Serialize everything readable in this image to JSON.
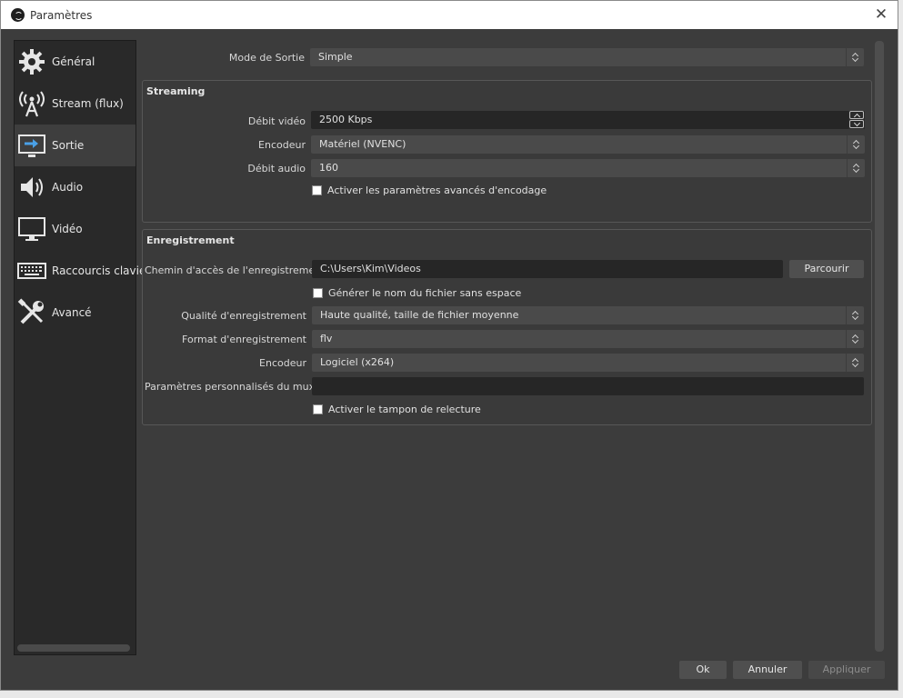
{
  "window": {
    "title": "Paramètres"
  },
  "sidebar": {
    "items": [
      {
        "label": "Général",
        "icon": "gear-icon"
      },
      {
        "label": "Stream (flux)",
        "icon": "antenna-icon"
      },
      {
        "label": "Sortie",
        "icon": "output-icon",
        "active": true
      },
      {
        "label": "Audio",
        "icon": "speaker-icon"
      },
      {
        "label": "Vidéo",
        "icon": "monitor-icon"
      },
      {
        "label": "Raccourcis clavier",
        "icon": "keyboard-icon"
      },
      {
        "label": "Avancé",
        "icon": "tools-icon"
      }
    ]
  },
  "output": {
    "mode_label": "Mode de Sortie",
    "mode_value": "Simple",
    "streaming": {
      "title": "Streaming",
      "video_bitrate_label": "Débit vidéo",
      "video_bitrate_value": "2500 Kbps",
      "encoder_label": "Encodeur",
      "encoder_value": "Matériel (NVENC)",
      "audio_bitrate_label": "Débit audio",
      "audio_bitrate_value": "160",
      "advanced_label": "Activer les paramètres avancés d'encodage"
    },
    "recording": {
      "title": "Enregistrement",
      "path_label": "Chemin d'accès de l'enregistrement",
      "path_value": "C:\\Users\\Kim\\Videos",
      "browse_label": "Parcourir",
      "nospace_label": "Générer le nom du fichier sans espace",
      "quality_label": "Qualité d'enregistrement",
      "quality_value": "Haute qualité, taille de fichier moyenne",
      "format_label": "Format d'enregistrement",
      "format_value": "flv",
      "encoder_label": "Encodeur",
      "encoder_value": "Logiciel (x264)",
      "muxer_label": "Paramètres personnalisés du muxer",
      "muxer_value": "",
      "replay_label": "Activer le tampon de relecture"
    }
  },
  "footer": {
    "ok_label": "Ok",
    "cancel_label": "Annuler",
    "apply_label": "Appliquer"
  }
}
